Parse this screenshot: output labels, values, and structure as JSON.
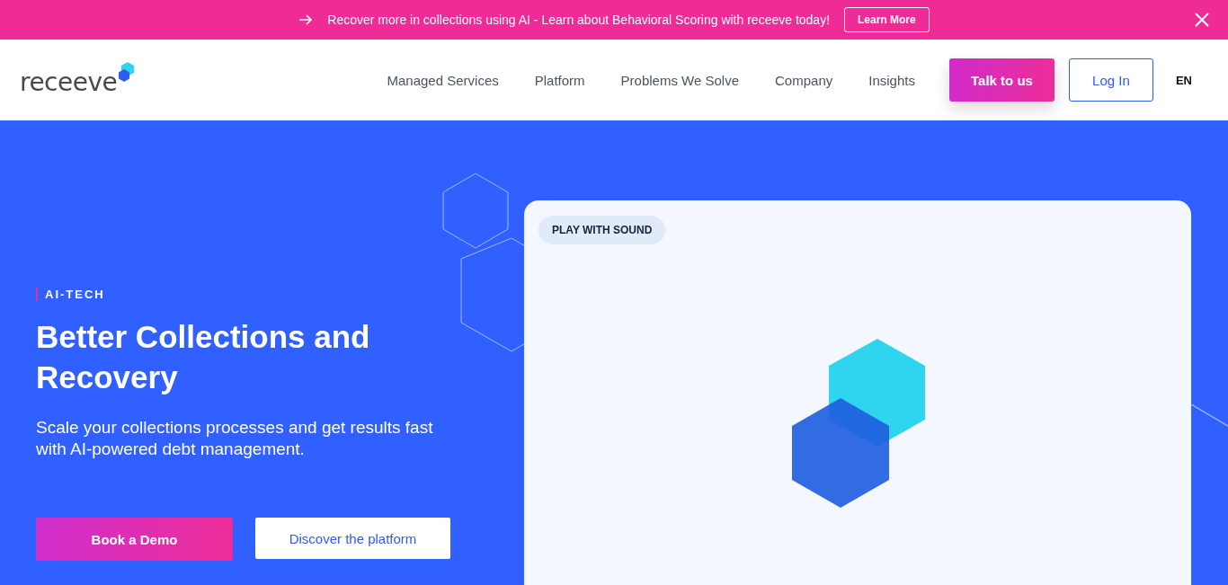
{
  "banner": {
    "text": "Recover more in collections using AI - Learn about Behavioral Scoring with receeve today!",
    "button": "Learn More"
  },
  "header": {
    "logo": "receeve",
    "nav": [
      "Managed Services",
      "Platform",
      "Problems We Solve",
      "Company",
      "Insights"
    ],
    "cta": "Talk to us",
    "login": "Log In",
    "language": "EN"
  },
  "hero": {
    "eyebrow": "AI-TECH",
    "title": "Better Collections and Recovery",
    "subtitle": "Scale your collections processes and get results fast with AI-powered debt management.",
    "buttons": [
      {
        "label": "Book a Demo",
        "kind": "primary"
      },
      {
        "label": "Discover the platform",
        "kind": "secondary"
      }
    ]
  },
  "video": {
    "badge": "PLAY WITH SOUND"
  }
}
